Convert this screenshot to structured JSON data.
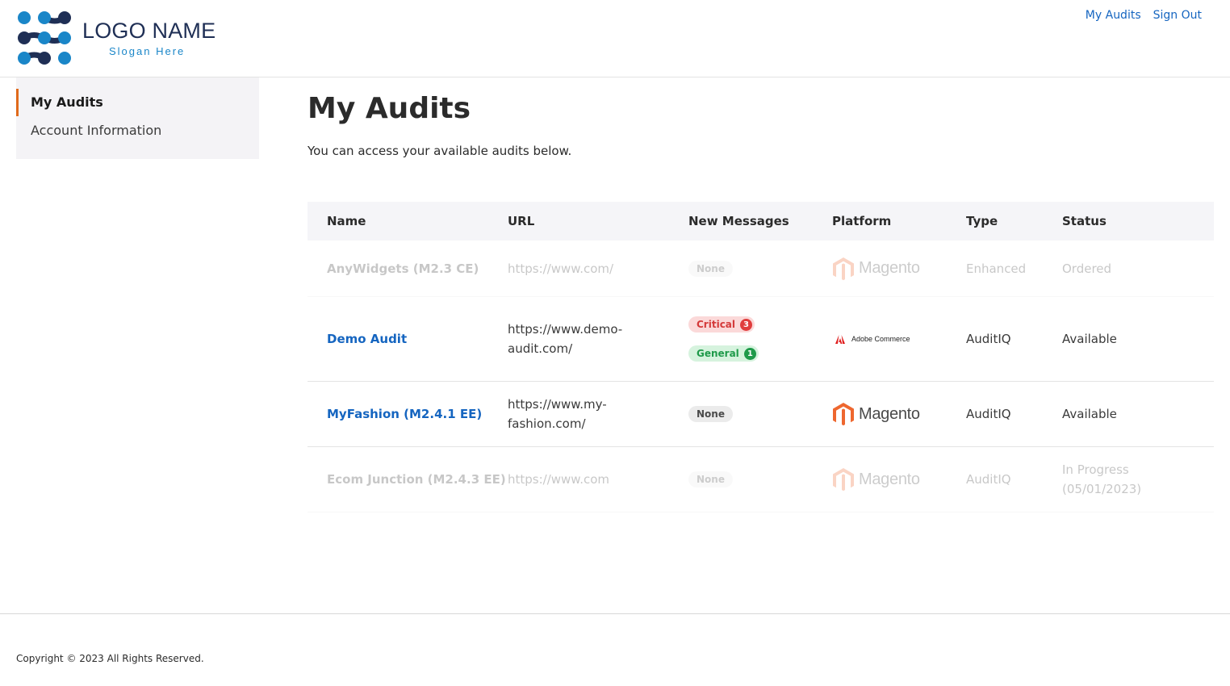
{
  "brand": {
    "name": "LOGO NAME",
    "slogan": "Slogan Here",
    "colors": {
      "dark": "#1f2f55",
      "accent": "#1a86c8"
    }
  },
  "top_nav": {
    "my_audits": "My Audits",
    "sign_out": "Sign Out"
  },
  "sidebar": {
    "items": [
      {
        "label": "My Audits",
        "active": true
      },
      {
        "label": "Account Information",
        "active": false
      }
    ]
  },
  "page": {
    "title": "My Audits",
    "subtitle": "You can access your available audits below."
  },
  "table": {
    "headers": [
      "Name",
      "URL",
      "New Messages",
      "Platform",
      "Type",
      "Status"
    ],
    "rows": [
      {
        "name": "AnyWidgets (M2.3 CE)",
        "url": "https://www.com/",
        "messages": {
          "none": "None"
        },
        "platform": "Magento",
        "type": "Enhanced",
        "status": "Ordered"
      },
      {
        "name": "Demo Audit",
        "url": "https://www.demo-audit.com/",
        "messages": {
          "critical_label": "Critical",
          "critical_count": "3",
          "general_label": "General",
          "general_count": "1"
        },
        "platform": "Adobe Commerce",
        "type": "AuditIQ",
        "status": "Available"
      },
      {
        "name": "MyFashion (M2.4.1 EE)",
        "url": "https://www.my-fashion.com/",
        "messages": {
          "none": "None"
        },
        "platform": "Magento",
        "type": "AuditIQ",
        "status": "Available"
      },
      {
        "name": "Ecom Junction (M2.4.3 EE)",
        "url": "https://www.com",
        "messages": {
          "none": "None"
        },
        "platform": "Magento",
        "type": "AuditIQ",
        "status": "In Progress (05/01/2023)"
      }
    ]
  },
  "footer": {
    "copyright": "Copyright © 2023 All Rights Reserved."
  },
  "colors": {
    "link": "#1565c0",
    "active_marker": "#e06a1b",
    "magento": "#ee672f"
  }
}
